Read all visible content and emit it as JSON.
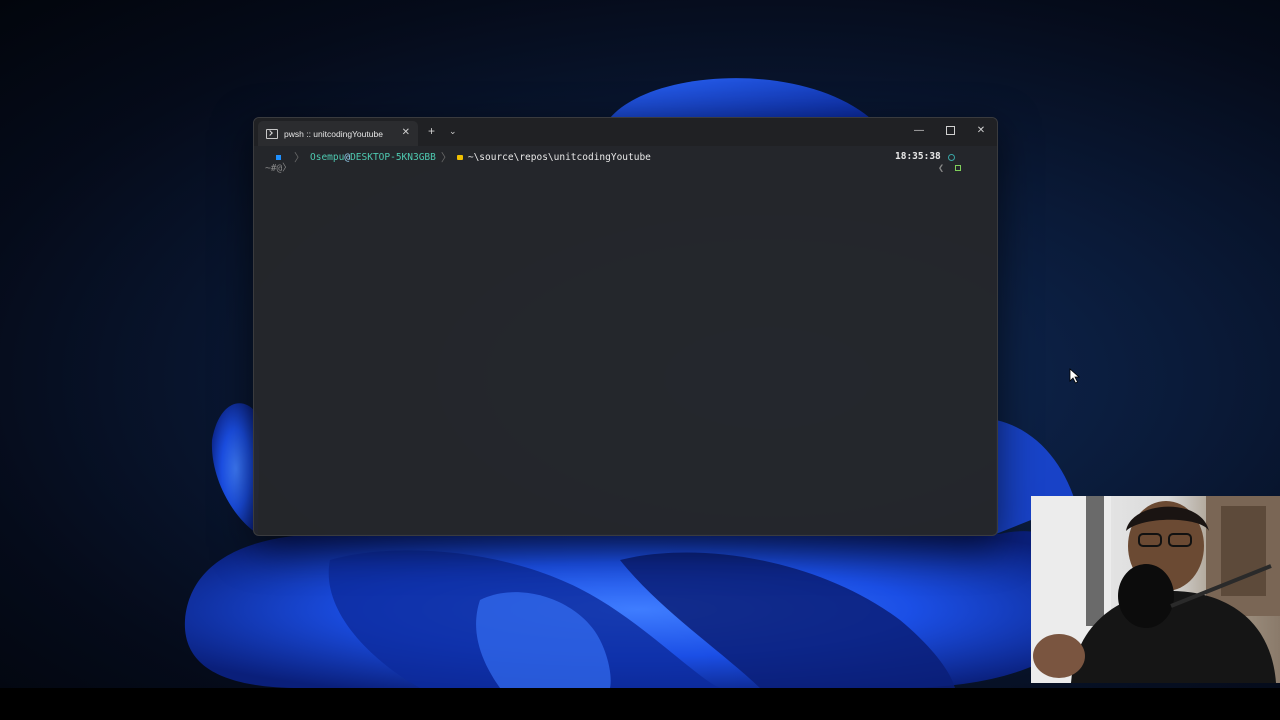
{
  "desktop": {
    "wallpaper_colors": {
      "background": "#050b1a",
      "bloom_primary": "#1f5bff",
      "bloom_dark": "#0a2a8f"
    }
  },
  "terminal": {
    "tab": {
      "icon": "powershell-icon",
      "title": "pwsh :: unitcodingYoutube",
      "close_glyph": "✕"
    },
    "new_tab_glyph": "+",
    "dropdown_glyph": "⌄",
    "window_controls": {
      "minimize_glyph": "—",
      "close_glyph": "✕"
    },
    "prompt": {
      "user": "Osempu",
      "at": "@",
      "host": "DESKTOP-5KN3GBB",
      "separator": "〉",
      "path": "~\\source\\repos\\unitcodingYoutube",
      "time": "18:35:38",
      "line2": "~#@〉",
      "right_prompt": "❮"
    },
    "colors": {
      "background": "#26272a",
      "titlebar": "#202124",
      "user": "#4ec9b0",
      "path": "#e8e8e8",
      "folder": "#f0c000",
      "os_icon": "#1e90ff"
    }
  },
  "webcam": {
    "description_icon": "webcam-overlay"
  }
}
